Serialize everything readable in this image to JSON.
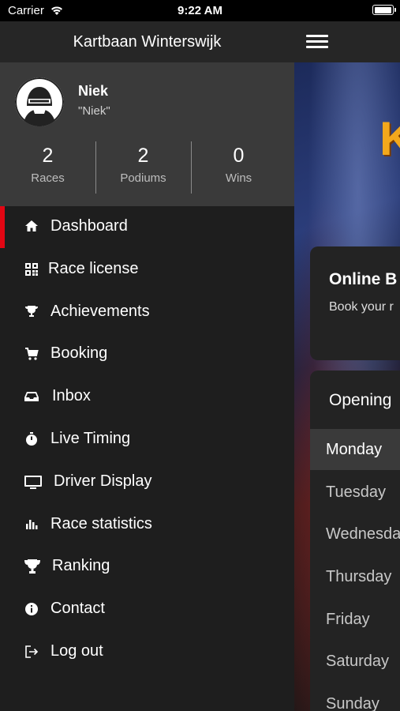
{
  "status_bar": {
    "carrier": "Carrier",
    "time": "9:22 AM",
    "battery_level": 1.0
  },
  "drawer": {
    "title": "Kartbaan Winterswijk",
    "profile": {
      "name": "Niek",
      "nickname": "\"Niek\"",
      "stats": [
        {
          "value": "2",
          "label": "Races"
        },
        {
          "value": "2",
          "label": "Podiums"
        },
        {
          "value": "0",
          "label": "Wins"
        }
      ]
    },
    "menu": [
      {
        "label": "Dashboard",
        "icon": "home-icon",
        "active": true
      },
      {
        "label": "Race license",
        "icon": "qr-code-icon",
        "active": false
      },
      {
        "label": "Achievements",
        "icon": "trophy-small-icon",
        "active": false
      },
      {
        "label": "Booking",
        "icon": "cart-icon",
        "active": false
      },
      {
        "label": "Inbox",
        "icon": "inbox-icon",
        "active": false
      },
      {
        "label": "Live Timing",
        "icon": "stopwatch-icon",
        "active": false
      },
      {
        "label": "Driver Display",
        "icon": "monitor-icon",
        "active": false
      },
      {
        "label": "Race statistics",
        "icon": "bar-chart-icon",
        "active": false
      },
      {
        "label": "Ranking",
        "icon": "trophy-icon",
        "active": false
      },
      {
        "label": "Contact",
        "icon": "info-icon",
        "active": false
      },
      {
        "label": "Log out",
        "icon": "logout-icon",
        "active": false
      }
    ]
  },
  "main": {
    "logo_text": "K",
    "booking_card": {
      "title": "Online B",
      "subtitle": "Book your r"
    },
    "hours_card": {
      "title": "Opening",
      "days": [
        "Monday",
        "Tuesday",
        "Wednesda",
        "Thursday",
        "Friday",
        "Saturday",
        "Sunday"
      ],
      "active_day": "Monday"
    }
  },
  "colors": {
    "accent": "#e30613",
    "drawer_bg": "#1e1e1e",
    "profile_bg": "#3a3a3a",
    "header_bg": "#262626",
    "logo": "#f3a81c"
  }
}
